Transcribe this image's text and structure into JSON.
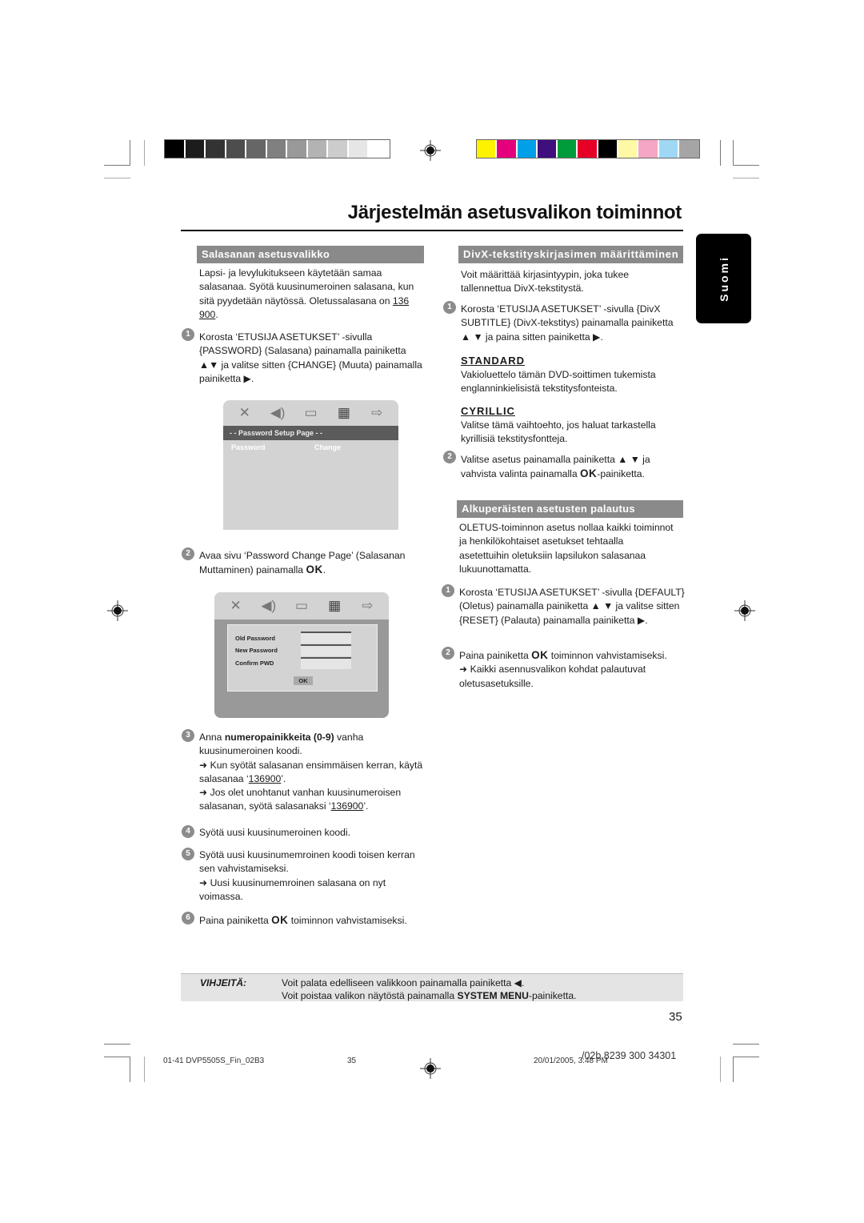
{
  "print_marks": {
    "grayscale_swatches": [
      "#000000",
      "#1c1c1c",
      "#333333",
      "#4d4d4d",
      "#666666",
      "#808080",
      "#999999",
      "#b3b3b3",
      "#cccccc",
      "#e6e6e6",
      "#ffffff"
    ],
    "color_swatches": [
      "#fff200",
      "#e4007c",
      "#00a0e9",
      "#3f0f7e",
      "#009c3b",
      "#e60026",
      "#000000",
      "#fff9a6",
      "#f5a6c4",
      "#9fd8f5",
      "#a5a5a5"
    ]
  },
  "header": {
    "title": "Järjestelmän asetusvalikon toiminnot"
  },
  "language_tab": "Suomi",
  "left_column": {
    "section_title": "Salasanan asetusvalikko",
    "intro": [
      "Lapsi- ja levylukitukseen käytetään samaa salasanaa. Syötä kuusinumeroinen salasana, kun sitä pyydetään näytössä. Oletussalasana on ",
      "136 900",
      "."
    ],
    "step1": {
      "number": "1",
      "text": "Korosta ‘ETUSIJA ASETUKSET’ -sivulla {PASSWORD} (Salasana) painamalla painiketta ▲▼ ja valitse sitten {CHANGE} (Muuta) painamalla painiketta ▶."
    },
    "osd1": {
      "icons": [
        "wrench-screwdriver-icon",
        "speaker-icon",
        "video-icon",
        "preferences-icon",
        "exit-icon"
      ],
      "bar_title": "- -  Password Setup Page  - -",
      "row_label": "Password",
      "row_value": "Change"
    },
    "step2": {
      "number": "2",
      "text_before": "Avaa sivu ‘Password Change Page’ (Salasanan Muttaminen) painamalla ",
      "bold": "OK",
      "text_after": "."
    },
    "osd2": {
      "fields": [
        {
          "label": "Old Password",
          "value": ""
        },
        {
          "label": "New Password",
          "value": ""
        },
        {
          "label": "Confirm PWD",
          "value": ""
        }
      ],
      "ok_label": "OK"
    },
    "step3": {
      "number": "3",
      "text_before": "Anna ",
      "bold": "numeropainikkeita (0-9)",
      "text_after": " vanha kuusinumeroinen koodi.",
      "note1_before": "➜ Kun syötät salasanan ensimmäisen kerran, käytä salasanaa ‘",
      "note1_code": "136900",
      "note1_after": "’.",
      "note2_before": "➜ Jos olet unohtanut vanhan kuusinumeroisen salasanan, syötä salasanaksi ‘",
      "note2_code": "136900",
      "note2_after": "’."
    },
    "step4": {
      "number": "4",
      "text": "Syötä uusi kuusinumeroinen koodi."
    },
    "step5": {
      "number": "5",
      "text": "Syötä uusi kuusinumemroinen koodi toisen kerran sen vahvistamiseksi.",
      "note": "➜ Uusi kuusinumemroinen salasana on nyt voimassa."
    },
    "step6": {
      "number": "6",
      "text_before": "Paina painiketta ",
      "bold": "OK",
      "text_after": " toiminnon vahvistamiseksi."
    }
  },
  "right_column": {
    "divx": {
      "section_title": "DivX-tekstityskirjasimen määrittäminen",
      "intro": "Voit määrittää kirjasintyypin, joka tukee tallennettua DivX-tekstitystä.",
      "step1": {
        "number": "1",
        "text": "Korosta ‘ETUSIJA ASETUKSET’ -sivulla {DivX SUBTITLE} (DivX-tekstitys) painamalla painiketta ▲ ▼ ja paina sitten painiketta ▶."
      },
      "options": [
        {
          "name": "STANDARD",
          "description": "Vakioluettelo tämän DVD-soittimen tukemista englanninkielisistä tekstitysfonteista."
        },
        {
          "name": "CYRILLIC",
          "description": "Valitse tämä vaihtoehto, jos haluat tarkastella kyrillisiä tekstitysfontteja."
        }
      ],
      "step2": {
        "number": "2",
        "text_before": "Valitse asetus painamalla painiketta ▲ ▼ ja vahvista valinta painamalla ",
        "bold": "OK",
        "text_after": "-painiketta."
      }
    },
    "reset": {
      "section_title": "Alkuperäisten asetusten palautus",
      "intro": "OLETUS-toiminnon asetus nollaa kaikki toiminnot ja henkilökohtaiset asetukset tehtaalla asetettuihin oletuksiin lapsilukon salasanaa lukuunottamatta.",
      "step1": {
        "number": "1",
        "text": "Korosta ‘ETUSIJA ASETUKSET’ -sivulla {DEFAULT} (Oletus) painamalla painiketta ▲ ▼ ja valitse sitten {RESET} (Palauta) painamalla painiketta ▶."
      },
      "step2": {
        "number": "2",
        "text_before": "Paina painiketta ",
        "bold": "OK",
        "text_after": " toiminnon vahvistamiseksi.",
        "note": "➜ Kaikki asennusvalikon kohdat palautuvat oletusasetuksille."
      }
    }
  },
  "tips": {
    "label": "VIHJEITÄ:",
    "line1": "Voit palata edelliseen valikkoon painamalla painiketta ◀.",
    "line2_before": "Voit poistaa valikon näytöstä painamalla ",
    "line2_bold": "SYSTEM MENU",
    "line2_after": "-painiketta."
  },
  "page_number": "35",
  "footer": {
    "file": "01-41 DVP5505S_Fin_02B3",
    "page": "35",
    "datetime": "20/01/2005, 3:48 PM",
    "code": "/02b 8239 300 34301"
  }
}
